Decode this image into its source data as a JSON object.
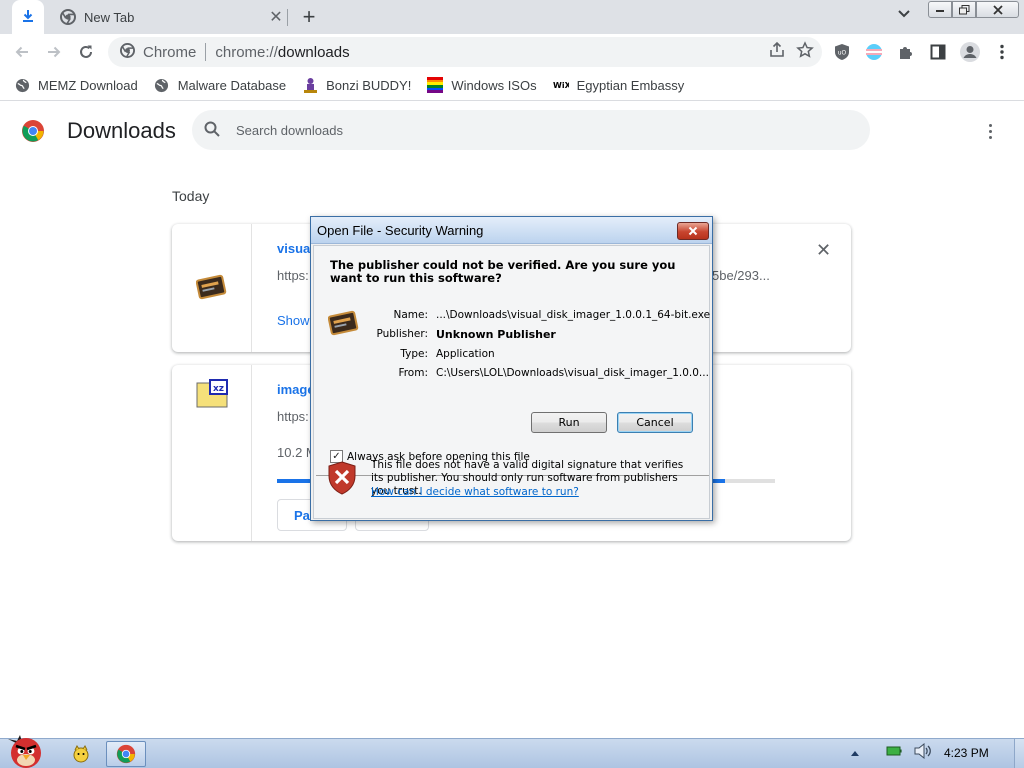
{
  "window": {
    "tabs": [
      {
        "label": "",
        "icon": "download-icon"
      },
      {
        "label": "New Tab",
        "icon": "chrome-icon"
      }
    ]
  },
  "omnibox": {
    "site_label": "Chrome",
    "url_prefix": "chrome://",
    "url_path": "downloads"
  },
  "bookmarks": [
    {
      "label": "MEMZ Download",
      "icon": "globe-icon"
    },
    {
      "label": "Malware Database",
      "icon": "globe-icon"
    },
    {
      "label": "Bonzi BUDDY!",
      "icon": "bonzi-icon"
    },
    {
      "label": "Windows ISOs",
      "icon": "rainbow-flag-icon"
    },
    {
      "label": "Egyptian Embassy",
      "icon": "wix-icon"
    }
  ],
  "downloads_page": {
    "title": "Downloads",
    "search_placeholder": "Search downloads",
    "date_header": "Today",
    "items": [
      {
        "name": "visual",
        "url": "https:",
        "url_tail": "5be/293...",
        "action_link": "Show",
        "icon": "disk-imager-icon"
      },
      {
        "name": "image",
        "url": "https:",
        "size": "10.2 M",
        "progress": 0.9,
        "pause_label": "Pa",
        "icon": "xz-archive-icon"
      }
    ]
  },
  "dialog": {
    "title": "Open File - Security Warning",
    "question": "The publisher could not be verified.  Are you sure you want to run this software?",
    "fields": [
      {
        "label": "Name:",
        "value": "...\\Downloads\\visual_disk_imager_1.0.0.1_64-bit.exe"
      },
      {
        "label": "Publisher:",
        "value": "Unknown Publisher"
      },
      {
        "label": "Type:",
        "value": "Application"
      },
      {
        "label": "From:",
        "value": "C:\\Users\\LOL\\Downloads\\visual_disk_imager_1.0.0..."
      }
    ],
    "run_label": "Run",
    "cancel_label": "Cancel",
    "checkbox_label": "Always ask before opening this file",
    "checkbox_checked": true,
    "warning_text": "This file does not have a valid digital signature that verifies its publisher.  You should only run software from publishers you trust.",
    "help_link": "How can I decide what software to run?"
  },
  "taskbar": {
    "time": "4:23 PM"
  },
  "colors": {
    "accent": "#1a73e8",
    "dialog_close": "#c8452f",
    "taskbar": "#b9cde8"
  }
}
